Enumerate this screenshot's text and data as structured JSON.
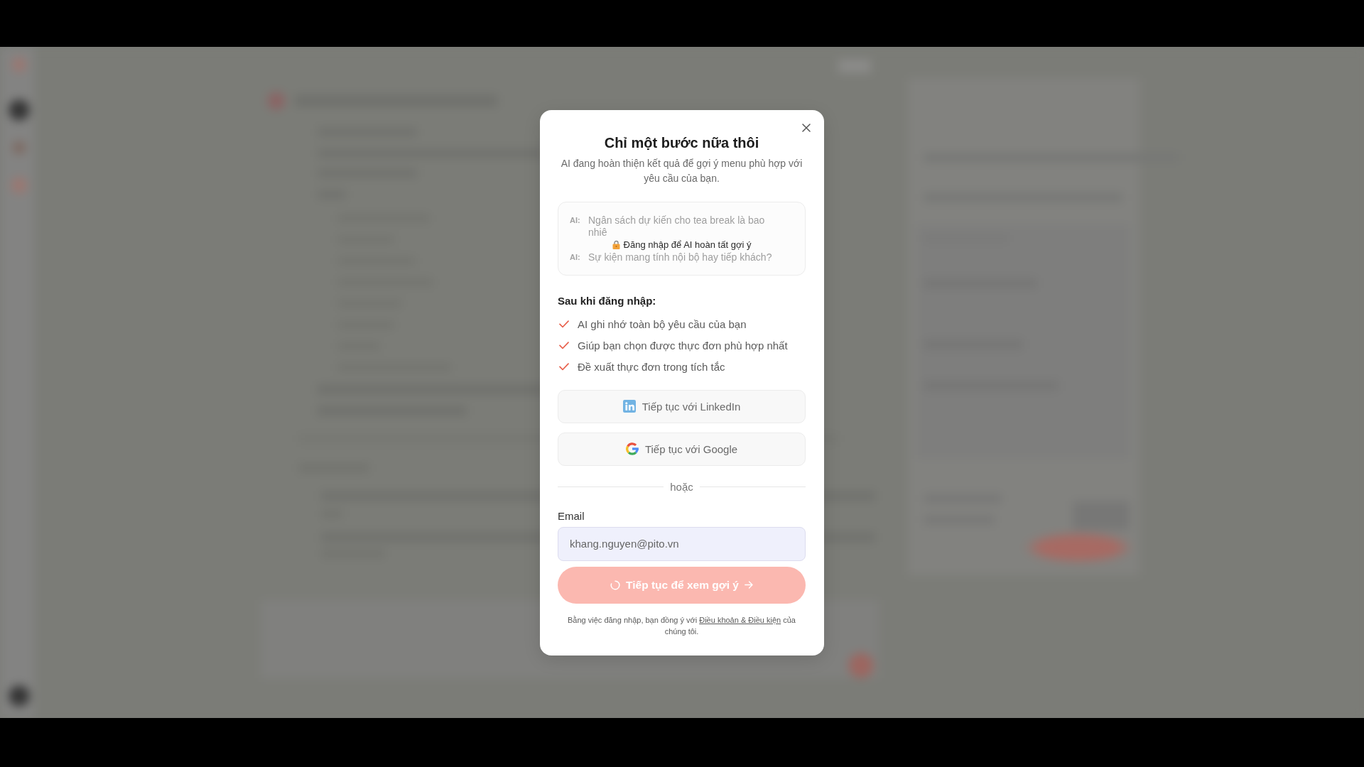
{
  "dialog": {
    "title": "Chỉ một bước nữa thôi",
    "subtitle": "AI đang hoàn thiện kết quả để gợi ý menu phù hợp với yêu cầu của bạn.",
    "preview": {
      "locked": true,
      "lines": [
        {
          "speaker": "AI:",
          "text": "Ngân sách dự kiến cho tea break là bao nhiê"
        },
        {
          "speaker": "AI:",
          "text": "Sự kiện mang tính nội bộ hay tiếp khách?"
        }
      ],
      "lock_message": "Đăng nhập để AI hoàn tất gợi ý"
    },
    "benefits": {
      "heading": "Sau khi đăng nhập:",
      "items": [
        "AI ghi nhớ toàn bộ yêu cầu của bạn",
        "Giúp bạn chọn được thực đơn phù hợp nhất",
        "Đề xuất thực đơn trong tích tắc"
      ]
    },
    "social_buttons": [
      {
        "kind": "linkedin",
        "label": "Tiếp tục với LinkedIn"
      },
      {
        "kind": "google",
        "label": "Tiếp tục với Google"
      }
    ],
    "divider": "hoặc",
    "email": {
      "label": "Email",
      "value": "khang.nguyen@pito.vn"
    },
    "submit": {
      "label": "Tiếp tục để xem gợi ý",
      "loading": true
    },
    "terms": {
      "before": "Bằng việc đăng nhập, bạn đồng ý với",
      "link": "Điều khoản & Điều kiện",
      "after": "của chúng tôi."
    }
  }
}
